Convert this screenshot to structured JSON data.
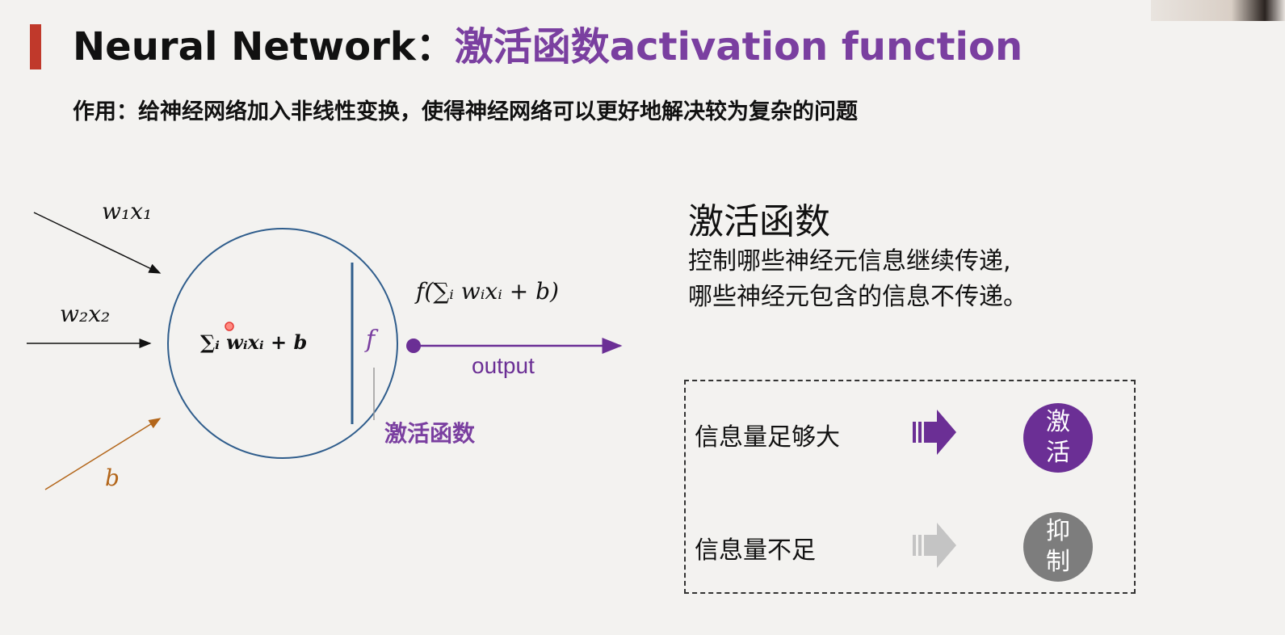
{
  "slide": {
    "title_main": "Neural Network：",
    "title_accent": "激活函数activation function",
    "subtitle": "作用：给神经网络加入非线性变换，使得神经网络可以更好地解决较为复杂的问题"
  },
  "diagram": {
    "input1": "w₁x₁",
    "input2": "w₂x₂",
    "input3": "b",
    "neuron_formula": "∑ᵢ wᵢxᵢ + b",
    "f_label": "f",
    "output_formula": "f(∑ᵢ wᵢxᵢ + b)",
    "output_label": "output",
    "activation_label": "激活函数"
  },
  "side": {
    "heading": "激活函数",
    "desc_line1": "控制哪些神经元信息继续传递,",
    "desc_line2": "哪些神经元包含的信息不传递。"
  },
  "panel": {
    "row1_label": "信息量足够大",
    "row1_badge_top": "激",
    "row1_badge_bottom": "活",
    "row2_label": "信息量不足",
    "row2_badge_top": "抑",
    "row2_badge_bottom": "制"
  },
  "colors": {
    "accent_purple": "#7a3fa0",
    "title_bar_red": "#c0392b",
    "bias_orange": "#b3661a",
    "neuron_blue": "#2f5d8c",
    "inhibit_gray": "#7d7d7d"
  }
}
